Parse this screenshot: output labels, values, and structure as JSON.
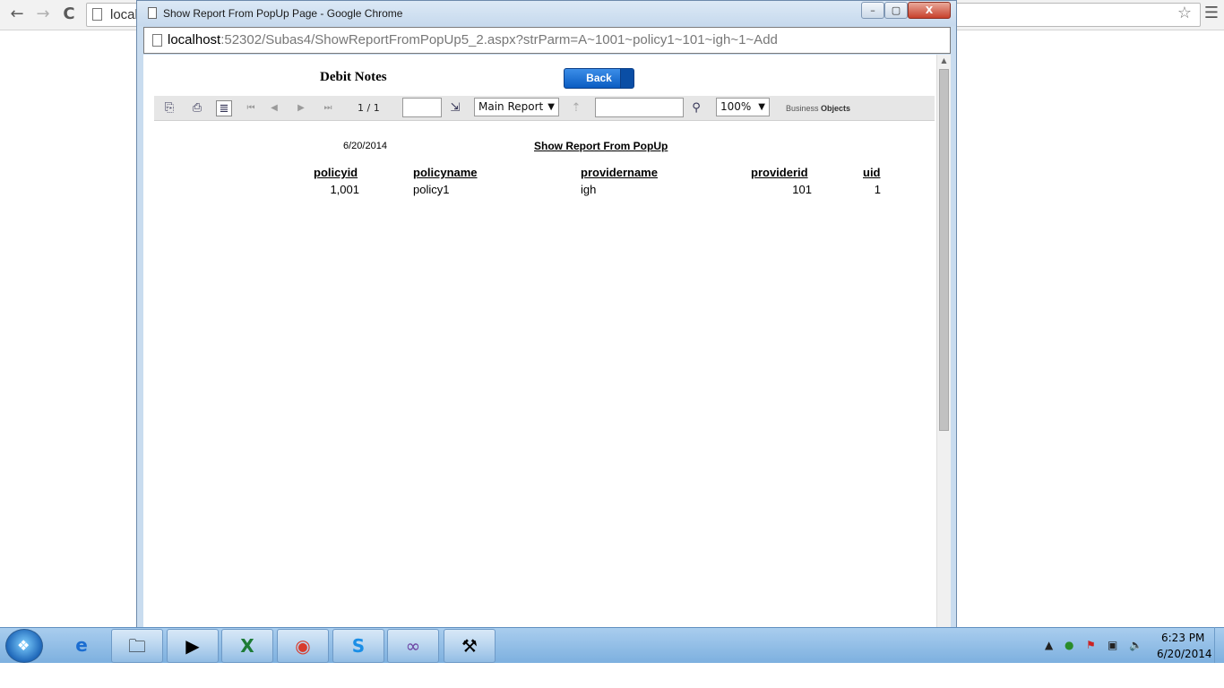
{
  "browser": {
    "address_text": "local",
    "nav": {
      "back": "←",
      "forward": "→",
      "reload": "C"
    }
  },
  "popup": {
    "window_title": "Show Report From PopUp Page - Google Chrome",
    "address_host": "localhost",
    "address_rest": ":52302/Subas4/ShowReportFromPopUp5_2.aspx?strParm=A~1001~policy1~101~igh~1~Add",
    "window_buttons": {
      "minimize": "–",
      "maximize": "▢",
      "close": "X"
    }
  },
  "report": {
    "title": "Debit Notes",
    "back_label": "Back",
    "toolbar": {
      "page_count": "1 / 1",
      "goto_value": "",
      "report_selector": "Main Report",
      "search_value": "",
      "zoom": "100%",
      "brand_prefix": "Business",
      "brand_name": "Objects"
    },
    "date": "6/20/2014",
    "subtitle": "Show Report From PopUp",
    "columns": [
      "policyid",
      "policyname",
      "providername",
      "providerid",
      "uid"
    ],
    "rows": [
      [
        "1,001",
        "policy1",
        "igh",
        "101",
        "1"
      ]
    ]
  },
  "taskbar": {
    "apps": [
      "ie-icon",
      "explorer-icon",
      "media-player-icon",
      "excel-icon",
      "chrome-icon",
      "skype-icon",
      "vs-icon",
      "sql-tools-icon"
    ],
    "clock_time": "6:23 PM",
    "clock_date": "6/20/2014"
  }
}
